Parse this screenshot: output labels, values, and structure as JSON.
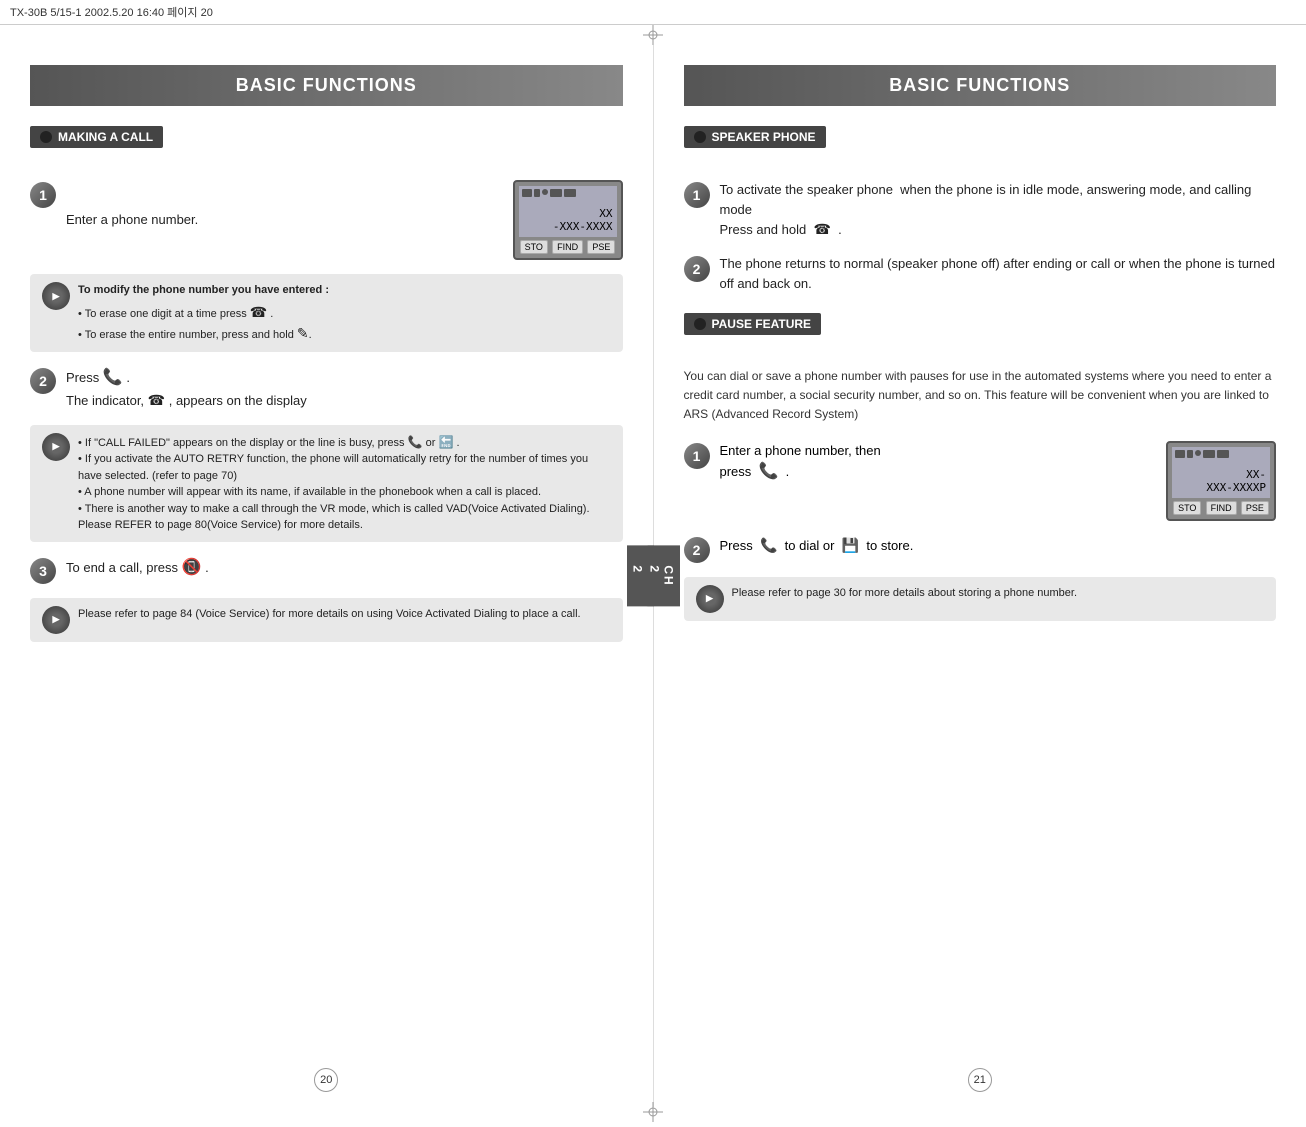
{
  "topBar": {
    "text": "TX-30B 5/15-1  2002.5.20  16:40 페이지 20"
  },
  "leftPage": {
    "title": "BASIC FUNCTIONS",
    "chapterTab": "CH\n2",
    "pageNumber": "20",
    "section1": {
      "header": "MAKING A CALL",
      "steps": [
        {
          "num": "1",
          "text": "Enter a phone number."
        },
        {
          "num": "2",
          "text": "Press",
          "suffix": " .\nThe indicator,    , appears on the display"
        },
        {
          "num": "3",
          "text": "To end a call, press    ."
        }
      ],
      "note1": {
        "title": "To modify the phone number you have entered :",
        "bullets": [
          "To erase one digit at a time press    .",
          "To erase the entire number, press and hold    ."
        ]
      },
      "note2": {
        "bullets": [
          "If \"CALL FAILED\" appears on the display or the line is busy, press    or    .",
          "If you activate the AUTO RETRY function, the phone will automatically retry for the number of times you have selected. (refer to page 70)",
          "A phone number will appear with its name, if available in the phonebook when a call is placed.",
          "There is another way to make a call through the VR mode, which is called VAD(Voice Activated Dialing). Please REFER to page 80(Voice Service) for more details."
        ]
      },
      "note3": {
        "text": "Please refer to page 84 (Voice Service) for more details on using Voice Activated Dialing to place a call."
      },
      "display1": {
        "topText": "XX",
        "bottomText": "-XXX-XXXX",
        "buttons": [
          "STO",
          "FIND",
          "PSE"
        ]
      }
    }
  },
  "rightPage": {
    "title": "BASIC FUNCTIONS",
    "chapterTab": "CH\n2",
    "pageNumber": "21",
    "section1": {
      "header": "SPEAKER PHONE",
      "steps": [
        {
          "num": "1",
          "text": "To activate the speaker phone  when the phone is in idle mode, answering mode, and calling mode\nPress and hold    ."
        },
        {
          "num": "2",
          "text": "The phone returns to normal (speaker phone off) after ending or call or when the phone is turned off and back on."
        }
      ]
    },
    "section2": {
      "header": "PAUSE FEATURE",
      "description": "You can dial or save a phone number with pauses for use in the automated systems where you need to enter a credit card number, a social security number, and so on. This feature will be convenient when you are linked to ARS (Advanced Record System)",
      "steps": [
        {
          "num": "1",
          "text": "Enter a phone number, then\npress    ."
        },
        {
          "num": "2",
          "text": "Press    to dial or    to store."
        }
      ],
      "note": {
        "text": "Please refer to page 30 for more details about storing a phone number."
      },
      "display": {
        "topText": "XX-",
        "bottomText": "XXX-XXXXP",
        "buttons": [
          "STO",
          "FIND",
          "PSE"
        ]
      }
    }
  }
}
